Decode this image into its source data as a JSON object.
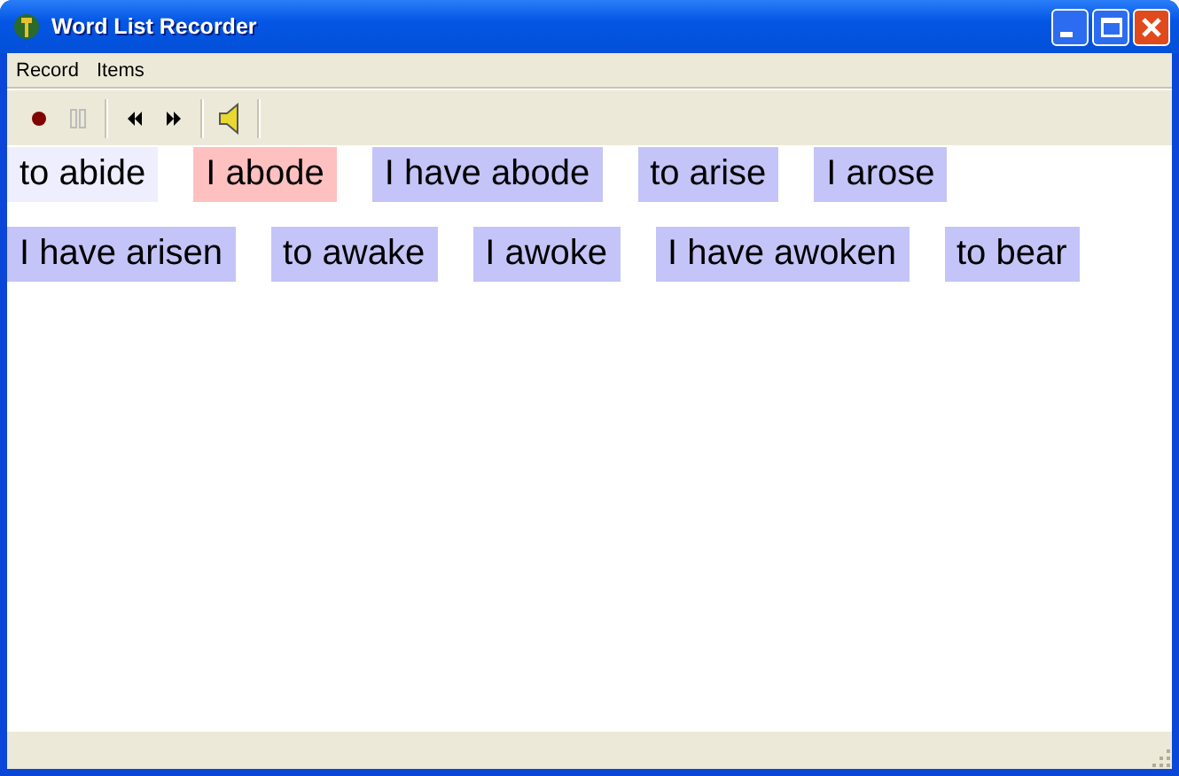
{
  "window": {
    "title": "Word List Recorder"
  },
  "menu": [
    "Record",
    "Items"
  ],
  "toolbar": [
    {
      "kind": "record",
      "disabled": false
    },
    {
      "kind": "pause",
      "disabled": true
    },
    {
      "kind": "sep"
    },
    {
      "kind": "rewind",
      "disabled": false
    },
    {
      "kind": "forward",
      "disabled": false
    },
    {
      "kind": "sep"
    },
    {
      "kind": "speaker",
      "disabled": false
    },
    {
      "kind": "sep"
    }
  ],
  "words": [
    {
      "text": "to abide",
      "color": "#eeeeff"
    },
    {
      "text": "I abode",
      "color": "#ffc0c0"
    },
    {
      "text": "I have abode",
      "color": "#c4c4f8"
    },
    {
      "text": "to arise",
      "color": "#c4c4f8"
    },
    {
      "text": "I arose",
      "color": "#c4c4f8"
    },
    {
      "text": "I have arisen",
      "color": "#c4c4f8"
    },
    {
      "text": "to awake",
      "color": "#c4c4f8"
    },
    {
      "text": "I awoke",
      "color": "#c4c4f8"
    },
    {
      "text": "I have awoken",
      "color": "#c4c4f8"
    },
    {
      "text": "to bear",
      "color": "#c4c4f8"
    }
  ]
}
